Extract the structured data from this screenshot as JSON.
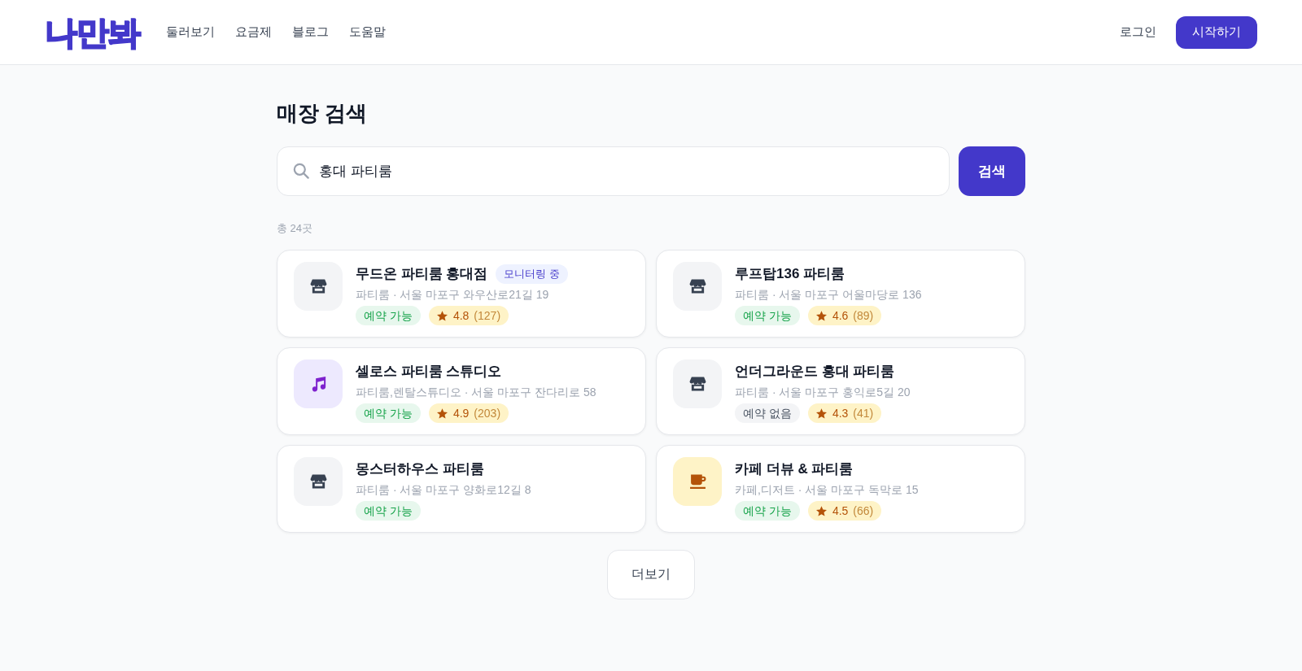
{
  "header": {
    "logo": "나만봐",
    "nav": [
      "둘러보기",
      "요금제",
      "블로그",
      "도움말"
    ],
    "login": "로그인",
    "start_button": "시작하기"
  },
  "page_title": "매장 검색",
  "search": {
    "value": "홍대 파티룸",
    "button": "검색"
  },
  "result_count": "총 24곳",
  "stores": [
    {
      "kind": "store",
      "name": "무드온 파티룸 홍대점",
      "badge": "모니터링 중",
      "address": "파티룸 · 서울 마포구 와우산로21길 19",
      "booking": {
        "label": "예약 가능",
        "available": true
      },
      "rating": {
        "score": "4.8",
        "count": "(127)"
      }
    },
    {
      "kind": "store",
      "name": "루프탑136 파티룸",
      "address": "파티룸 · 서울 마포구 어울마당로 136",
      "booking": {
        "label": "예약 가능",
        "available": true
      },
      "rating": {
        "score": "4.6",
        "count": "(89)"
      }
    },
    {
      "kind": "music",
      "name": "셀로스 파티룸 스튜디오",
      "address": "파티룸,렌탈스튜디오 · 서울 마포구 잔다리로 58",
      "booking": {
        "label": "예약 가능",
        "available": true
      },
      "rating": {
        "score": "4.9",
        "count": "(203)"
      }
    },
    {
      "kind": "store",
      "name": "언더그라운드 홍대 파티룸",
      "address": "파티룸 · 서울 마포구 홍익로5길 20",
      "booking": {
        "label": "예약 없음",
        "available": false
      },
      "rating": {
        "score": "4.3",
        "count": "(41)"
      }
    },
    {
      "kind": "store",
      "name": "몽스터하우스 파티룸",
      "address": "파티룸 · 서울 마포구 양화로12길 8",
      "booking": {
        "label": "예약 가능",
        "available": true
      }
    },
    {
      "kind": "cafe",
      "name": "카페 더뷰 & 파티룸",
      "address": "카페,디저트 · 서울 마포구 독막로 15",
      "booking": {
        "label": "예약 가능",
        "available": true
      },
      "rating": {
        "score": "4.5",
        "count": "(66)"
      }
    }
  ],
  "load_more": "더보기"
}
